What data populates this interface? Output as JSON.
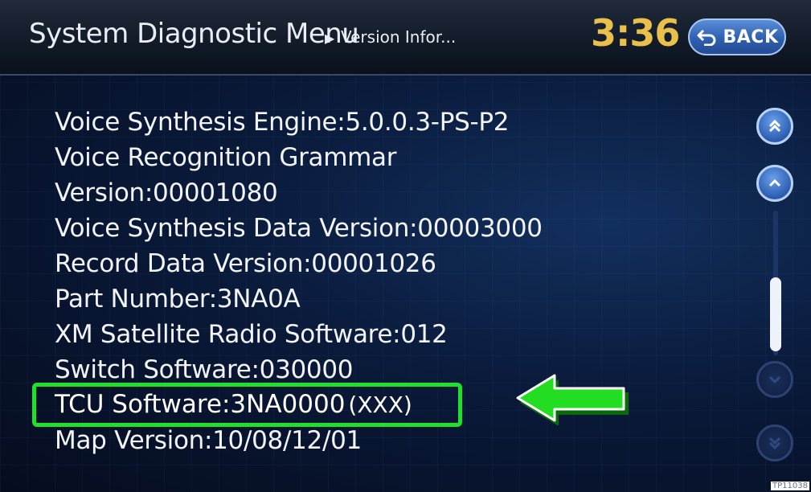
{
  "header": {
    "title": "System Diagnostic Menu",
    "breadcrumb": "Version Infor...",
    "clock": "3:36",
    "back_label": "BACK"
  },
  "rows": [
    "Voice Synthesis Engine:5.0.0.3-PS-P2",
    "Voice Recognition Grammar",
    "Version:00001080",
    "Voice Synthesis Data Version:00003000",
    "Record Data Version:00001026",
    "Part Number:3NA0A",
    "XM Satellite Radio Software:012",
    "Switch Software:030000",
    "TCU Software:3NA0000",
    "Map Version:10/08/12/01"
  ],
  "highlight": {
    "extra": "(XXX)",
    "box_color": "#1fe02a",
    "arrow_color": "#22dd22"
  },
  "scroll": {
    "position": 0.6
  },
  "footer_code": "TP11038"
}
